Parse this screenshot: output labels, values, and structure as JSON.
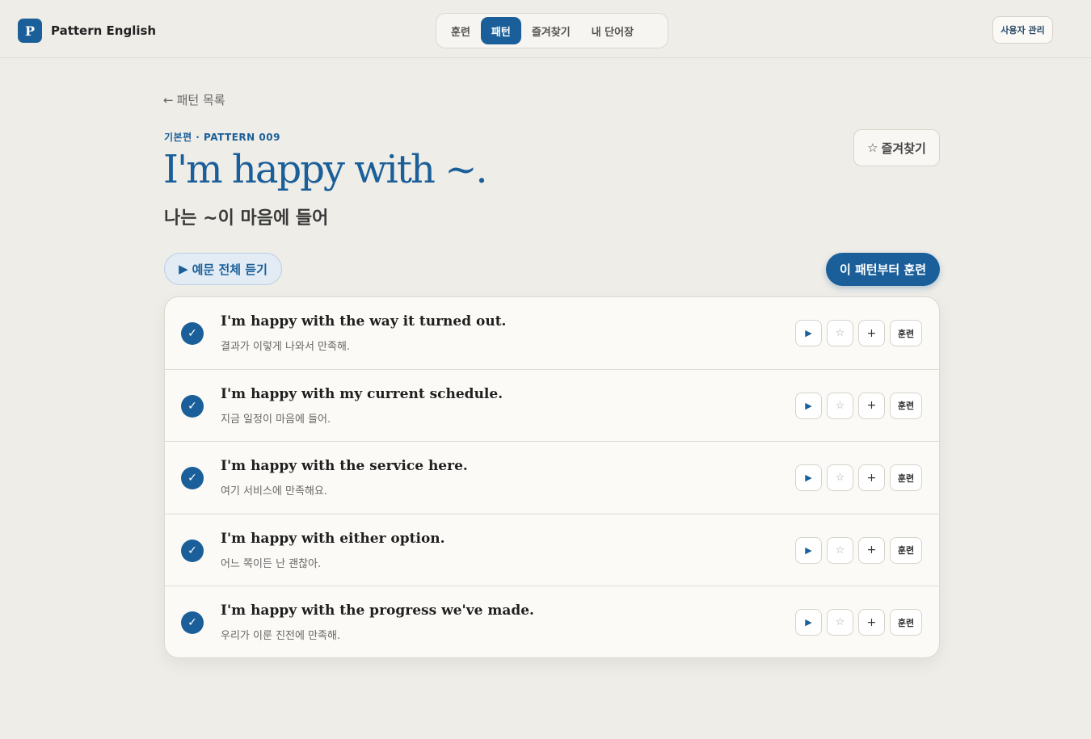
{
  "header": {
    "logo_letter": "P",
    "brand_name": "Pattern English",
    "nav": [
      {
        "label": "훈련",
        "active": false
      },
      {
        "label": "패턴",
        "active": true
      },
      {
        "label": "즐겨찾기",
        "active": false
      },
      {
        "label": "내 단어장",
        "active": false
      }
    ],
    "admin_label": "사용자 관리"
  },
  "page": {
    "back_label": "패턴 목록",
    "eyebrow": "기본편 · PATTERN 009",
    "title": "I'm happy with ~.",
    "subtitle": "나는 ~이 마음에 들어",
    "favorite_label": "즐겨찾기",
    "listen_all_label": "예문 전체 듣기",
    "train_from_label": "이 패턴부터 훈련"
  },
  "examples": [
    {
      "en": "I'm happy with the way it turned out.",
      "ko": "결과가 이렇게 나와서 만족해."
    },
    {
      "en": "I'm happy with my current schedule.",
      "ko": "지금 일정이 마음에 들어."
    },
    {
      "en": "I'm happy with the service here.",
      "ko": "여기 서비스에 만족해요."
    },
    {
      "en": "I'm happy with either option.",
      "ko": "어느 쪽이든 난 괜찮아."
    },
    {
      "en": "I'm happy with the progress we've made.",
      "ko": "우리가 이룬 진전에 만족해."
    }
  ],
  "row_actions": {
    "train_label": "훈련"
  },
  "colors": {
    "accent": "#1a5f99",
    "background": "#efede8",
    "card": "#fbfaf6"
  }
}
